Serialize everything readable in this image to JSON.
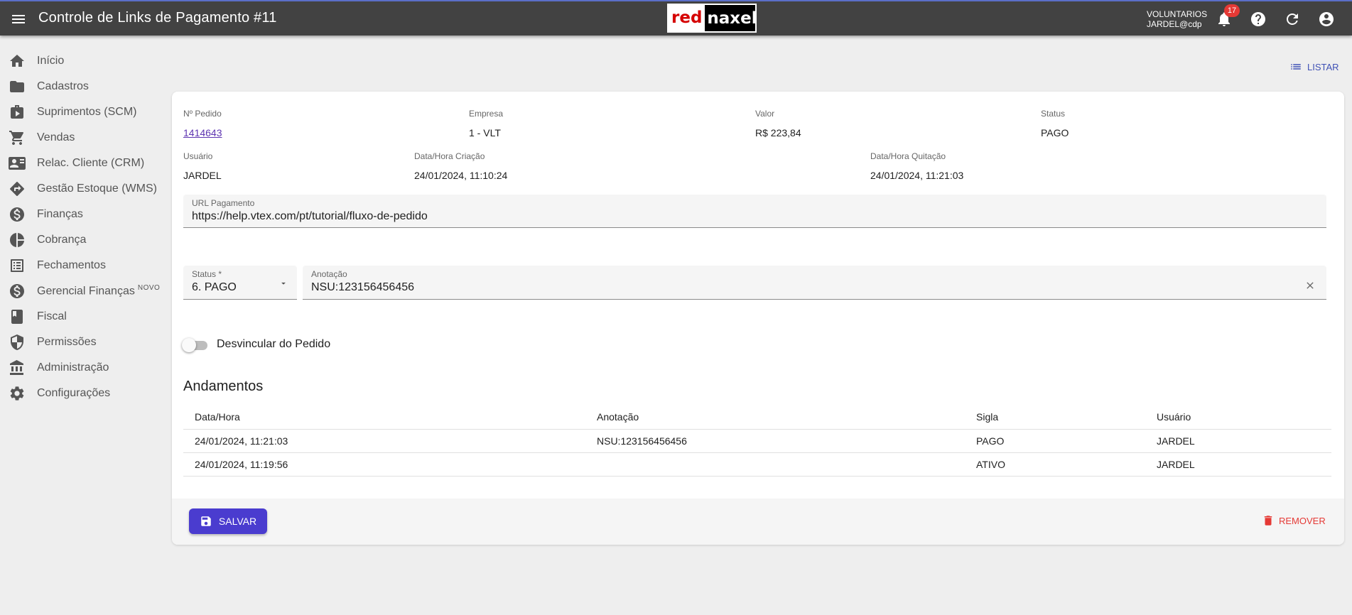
{
  "header": {
    "title": "Controle de Links de Pagamento #11",
    "logo_red": "red",
    "logo_rest": "naxel",
    "user_org": "VOLUNTARIOS",
    "user_name": "JARDEL@cdp",
    "notifications_count": "17"
  },
  "sidebar": {
    "items": [
      {
        "label": "Início",
        "icon": "home-icon"
      },
      {
        "label": "Cadastros",
        "icon": "folder-icon"
      },
      {
        "label": "Suprimentos (SCM)",
        "icon": "suitcase-icon"
      },
      {
        "label": "Vendas",
        "icon": "cart-icon"
      },
      {
        "label": "Relac. Cliente (CRM)",
        "icon": "contact-card-icon"
      },
      {
        "label": "Gestão Estoque (WMS)",
        "icon": "route-icon"
      },
      {
        "label": "Finanças",
        "icon": "dollar-circle-icon"
      },
      {
        "label": "Cobrança",
        "icon": "pie-chart-icon"
      },
      {
        "label": "Fechamentos",
        "icon": "list-alt-icon"
      },
      {
        "label": "Gerencial Finanças",
        "badge": "NOVO",
        "icon": "dollar-circle-icon"
      },
      {
        "label": "Fiscal",
        "icon": "book-icon"
      },
      {
        "label": "Permissões",
        "icon": "shield-icon"
      },
      {
        "label": "Administração",
        "icon": "bank-icon"
      },
      {
        "label": "Configurações",
        "icon": "gear-icon"
      }
    ]
  },
  "toolbar": {
    "listar_label": "LISTAR"
  },
  "details": {
    "pedido_label": "Nº Pedido",
    "pedido_value": "1414643",
    "empresa_label": "Empresa",
    "empresa_value": "1 - VLT",
    "valor_label": "Valor",
    "valor_value": "R$ 223,84",
    "status_label": "Status",
    "status_value": "PAGO",
    "usuario_label": "Usuário",
    "usuario_value": "JARDEL",
    "criacao_label": "Data/Hora Criação",
    "criacao_value": "24/01/2024, 11:10:24",
    "quitacao_label": "Data/Hora Quitação",
    "quitacao_value": "24/01/2024, 11:21:03"
  },
  "form": {
    "url_label": "URL Pagamento",
    "url_value": "https://help.vtex.com/pt/tutorial/fluxo-de-pedido",
    "status_label": "Status *",
    "status_value": "6. PAGO",
    "anotacao_label": "Anotação",
    "anotacao_value": "NSU:123156456456",
    "toggle_label": "Desvincular do Pedido",
    "toggle_on": false
  },
  "andamentos": {
    "title": "Andamentos",
    "columns": [
      "Data/Hora",
      "Anotação",
      "Sigla",
      "Usuário"
    ],
    "rows": [
      [
        "24/01/2024, 11:21:03",
        "NSU:123156456456",
        "PAGO",
        "JARDEL"
      ],
      [
        "24/01/2024, 11:19:56",
        "",
        "ATIVO",
        "JARDEL"
      ]
    ]
  },
  "actions": {
    "save_label": "SALVAR",
    "remove_label": "REMOVER"
  },
  "colors": {
    "topbar": "#424242",
    "primary": "#4a3ccf",
    "danger": "#e53935",
    "link": "#5e35b1"
  }
}
